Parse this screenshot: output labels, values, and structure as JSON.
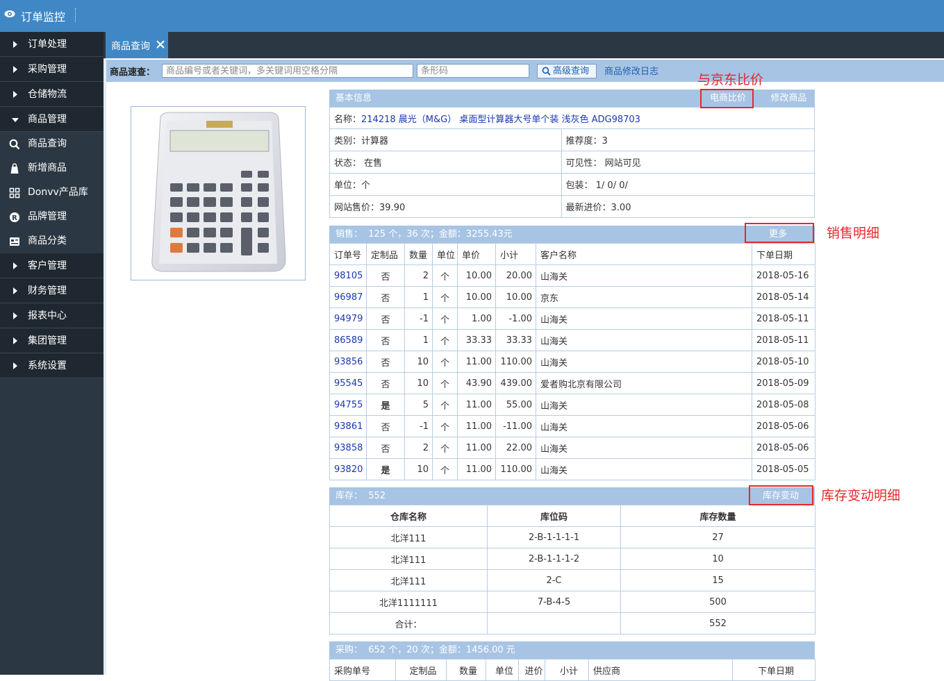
{
  "app": {
    "title": "订单监控"
  },
  "sidebar": {
    "top_items": [
      "订单处理",
      "采购管理",
      "仓储物流"
    ],
    "expanded": "商品管理",
    "sub_items": [
      {
        "label": "商品查询",
        "icon": "search-icon"
      },
      {
        "label": "新增商品",
        "icon": "bag-icon"
      },
      {
        "label": "Donvv产品库",
        "icon": "grid-icon"
      },
      {
        "label": "品牌管理",
        "icon": "registered-icon"
      },
      {
        "label": "商品分类",
        "icon": "category-icon"
      }
    ],
    "bottom_items": [
      "客户管理",
      "财务管理",
      "报表中心",
      "集团管理",
      "系统设置"
    ]
  },
  "tabs": [
    {
      "label": "商品查询",
      "closable": true
    }
  ],
  "search": {
    "label": "商品速查：",
    "keyword_placeholder": "商品编号或者关键词，多关键词用空格分隔",
    "barcode_placeholder": "条形码",
    "advanced_label": "高级查询",
    "log_link": "商品修改日志"
  },
  "basic": {
    "title": "基本信息",
    "compare_btn": "电商比价",
    "edit_btn": "修改商品",
    "name_label": "名称：",
    "name_value": "214218 晨光（M&G） 桌面型计算器大号单个装 浅灰色 ADG98703",
    "rows": [
      [
        {
          "label": "类别：",
          "value": "计算器"
        },
        {
          "label": "推荐度：",
          "value": "3"
        }
      ],
      [
        {
          "label": "状态：",
          "value": " 在售"
        },
        {
          "label": "可见性：",
          "value": " 网站可见"
        }
      ],
      [
        {
          "label": "单位：",
          "value": "个"
        },
        {
          "label": "包装：",
          "value": " 1/ 0/ 0/"
        }
      ],
      [
        {
          "label": "网站售价：",
          "value": "39.90"
        },
        {
          "label": "最新进价：",
          "value": "3.00"
        }
      ]
    ]
  },
  "sales": {
    "summary": "销售：  125 个，36 次；金额：3255.43元",
    "more_btn": "更多",
    "columns": [
      "订单号",
      "定制品",
      "数量",
      "单位",
      "单价",
      "小计",
      "客户名称",
      "下单日期"
    ],
    "rows": [
      [
        "98105",
        "否",
        "2",
        "个",
        "10.00",
        "20.00",
        "山海关",
        "2018-05-16"
      ],
      [
        "96987",
        "否",
        "1",
        "个",
        "10.00",
        "10.00",
        "京东",
        "2018-05-14"
      ],
      [
        "94979",
        "否",
        "-1",
        "个",
        "1.00",
        "-1.00",
        "山海关",
        "2018-05-11"
      ],
      [
        "86589",
        "否",
        "1",
        "个",
        "33.33",
        "33.33",
        "山海关",
        "2018-05-11"
      ],
      [
        "93856",
        "否",
        "10",
        "个",
        "11.00",
        "110.00",
        "山海关",
        "2018-05-10"
      ],
      [
        "95545",
        "否",
        "10",
        "个",
        "43.90",
        "439.00",
        "爱者购北京有限公司",
        "2018-05-09"
      ],
      [
        "94755",
        "是",
        "5",
        "个",
        "11.00",
        "55.00",
        "山海关",
        "2018-05-08"
      ],
      [
        "93861",
        "否",
        "-1",
        "个",
        "11.00",
        "-11.00",
        "山海关",
        "2018-05-06"
      ],
      [
        "93858",
        "否",
        "2",
        "个",
        "11.00",
        "22.00",
        "山海关",
        "2018-05-06"
      ],
      [
        "93820",
        "是",
        "10",
        "个",
        "11.00",
        "110.00",
        "山海关",
        "2018-05-05"
      ]
    ]
  },
  "stock": {
    "summary": "库存：  552",
    "change_btn": "库存变动",
    "columns": [
      "仓库名称",
      "库位码",
      "库存数量"
    ],
    "rows": [
      [
        "北洋111",
        "2-B-1-1-1-1",
        "27"
      ],
      [
        "北洋111",
        "2-B-1-1-1-2",
        "10"
      ],
      [
        "北洋111",
        "2-C",
        "15"
      ],
      [
        "北洋1111111",
        "7-B-4-5",
        "500"
      ]
    ],
    "total_label": "合计：",
    "total_value": "552"
  },
  "purchase": {
    "summary": "采购：  652 个，20 次；金额：1456.00 元",
    "columns": [
      "采购单号",
      "定制品",
      "数量",
      "单位",
      "进价",
      "小计",
      "供应商",
      "下单日期"
    ]
  },
  "annotations": {
    "compare": "与京东比价",
    "sales_detail": "销售明细",
    "stock_detail": "库存变动明细"
  },
  "colors": {
    "header_blue": "#3f88c5",
    "panel_blue": "#a7c4e4",
    "sidebar_dark": "#2b3742",
    "annotation_red": "#e8262a"
  }
}
